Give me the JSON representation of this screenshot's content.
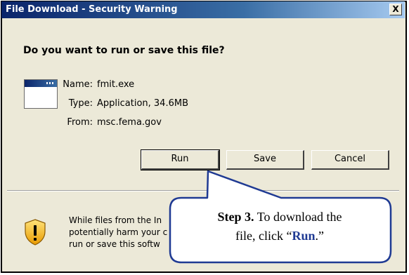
{
  "window": {
    "title": "File Download - Security Warning",
    "close_label": "X"
  },
  "question": "Do you want to run or save this file?",
  "file": {
    "icon": "application-window-icon",
    "name_label": "Name:",
    "name_value": "fmit.exe",
    "type_label": "Type:",
    "type_value": "Application, 34.6MB",
    "from_label": "From:",
    "from_value": "msc.fema.gov"
  },
  "buttons": {
    "run": "Run",
    "save": "Save",
    "cancel": "Cancel"
  },
  "warning": {
    "icon": "shield-warning-icon",
    "line1": "While files from the In",
    "line2": "potentially harm your c",
    "line3": "run or save this softw"
  },
  "callout": {
    "step": "Step 3.",
    "text_a": " To download the",
    "text_b": "file, click “",
    "run": "Run",
    "text_c": ".”"
  },
  "colors": {
    "dialog_bg": "#ece9d8",
    "title_bar": "#0a246a",
    "callout_fill": "#ffffff",
    "callout_border": "#1f3a93",
    "run_highlight": "#1f3a93"
  }
}
